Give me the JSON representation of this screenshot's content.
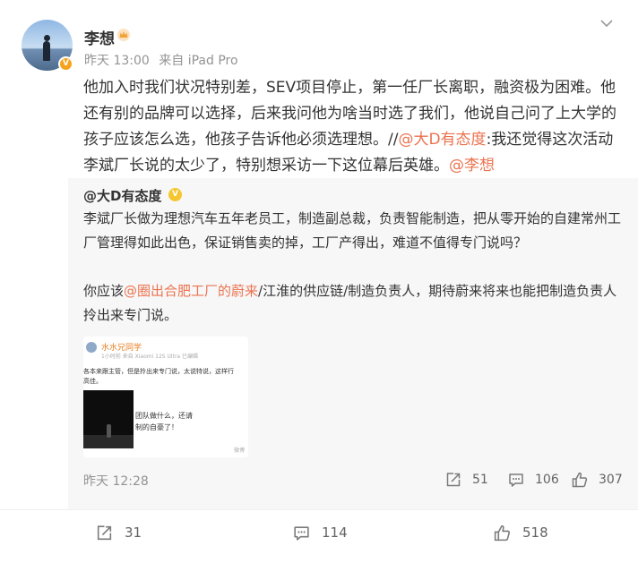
{
  "post": {
    "author": "李想",
    "time": "昨天 13:00",
    "source": "来自 iPad Pro",
    "text_main": "他加入时我们状况特别差，SEV项目停止，第一任厂长离职，融资极为困难。他还有别的品牌可以选择，后来我问他为啥当时选了我们，他说自己问了上大学的孩子应该怎么选，他孩子告诉他必须选理想。//",
    "mention_1": "@大D有态度",
    "text_mid": ":我还觉得这次活动李斌厂长说的太少了，特别想采访一下这位幕后英雄。",
    "mention_2": "@李想"
  },
  "quote": {
    "author": "@大D有态度",
    "para_1": "李斌厂长做为理想汽车五年老员工，制造副总裁，负责智能制造，把从零开始的自建常州工厂管理得如此出色，保证销售卖的掉，工厂产得出，难道不值得专门说吗？",
    "para_2_prefix": "你应该",
    "para_2_mention": "@圈出合肥工厂的蔚来",
    "para_2_suffix": "/江淮的供应链/制造负责人，期待蔚来将来也能把制造负责人拎出来专门说。",
    "time": "昨天 12:28",
    "repost_count": "51",
    "comment_count": "106",
    "like_count": "307",
    "image": {
      "name": "水水兄同学",
      "meta": "1小时前  来自 Xiaomi 12S Ultra  已编辑",
      "line_1": "各本来跟主管，但是拎出来专门说，太说特说，这样行",
      "line_2": "高佳。",
      "overlay_1": "团队做什么，还请",
      "overlay_2": "制的自豪了！",
      "watermark": "微博"
    }
  },
  "actions": {
    "repost_count": "31",
    "comment_count": "114",
    "like_count": "518"
  },
  "colors": {
    "mention": "#eb7350",
    "meta": "#939393",
    "quote_bg": "#f7f7f7",
    "verified_orange": "#f6a31b"
  },
  "icons": [
    "crown-icon",
    "chevron-down-icon",
    "repost-icon",
    "comment-icon",
    "like-icon",
    "verified-badge-icon"
  ]
}
